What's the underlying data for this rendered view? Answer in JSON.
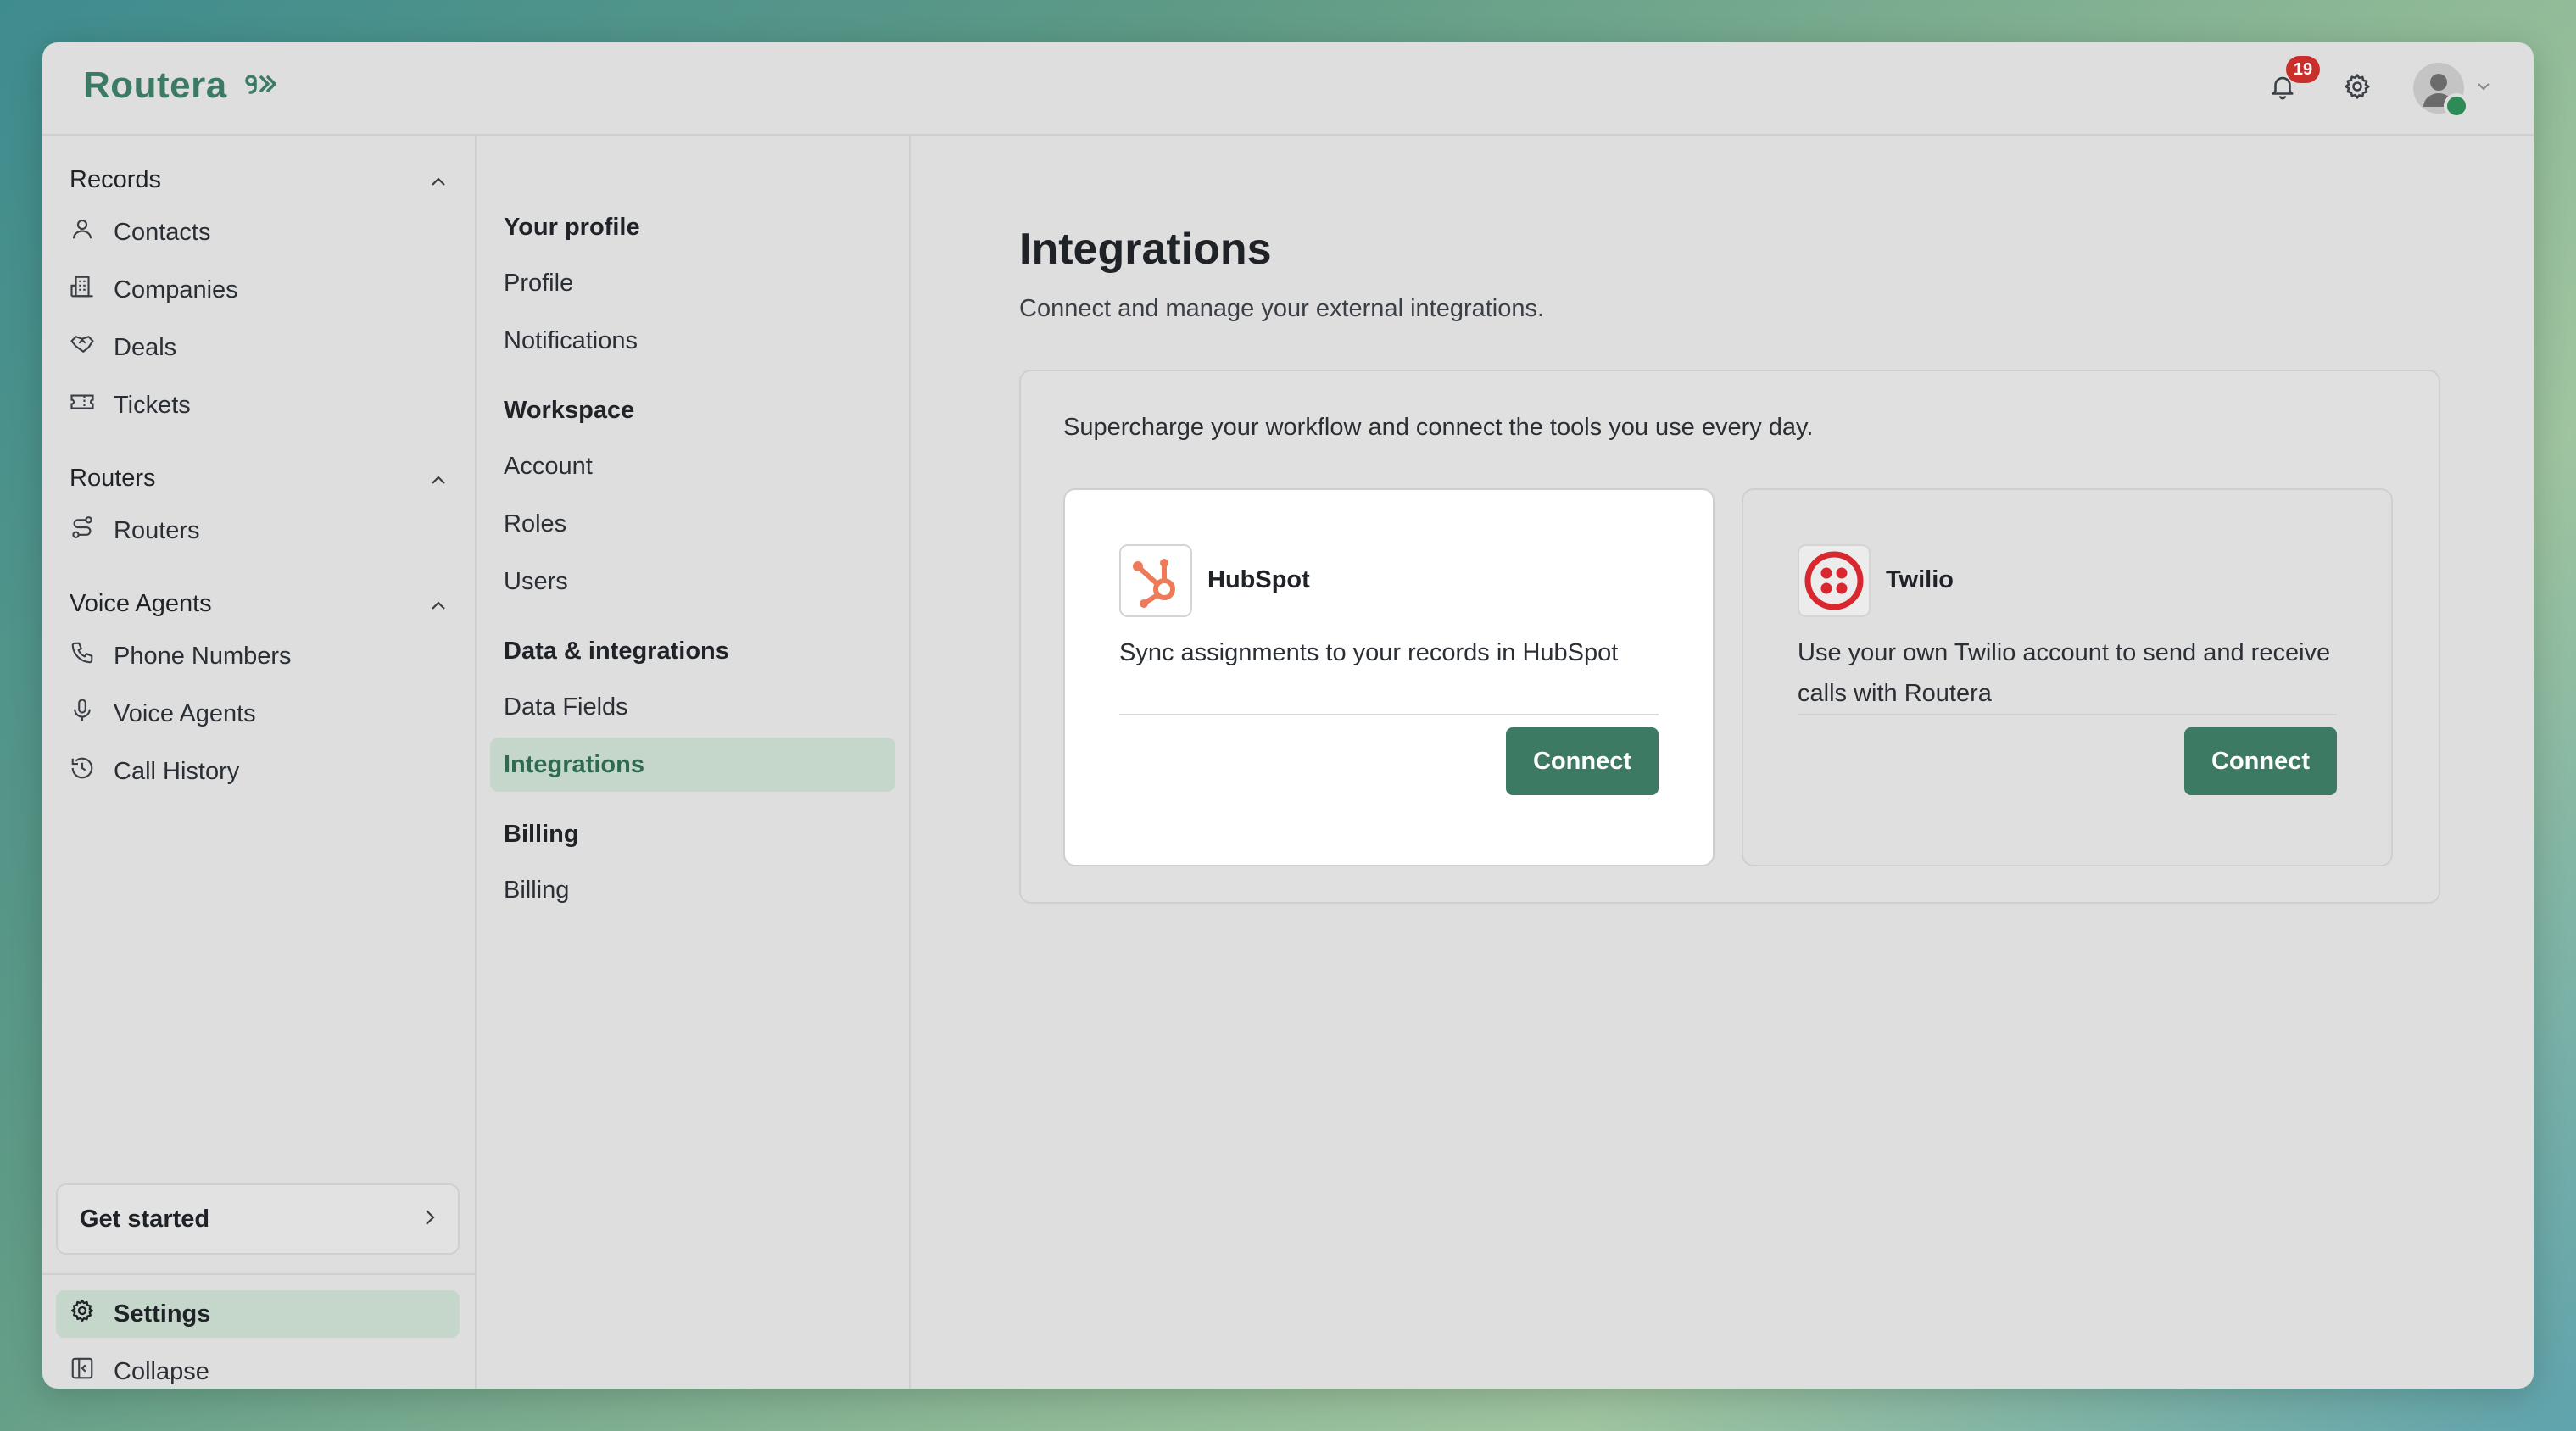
{
  "app": {
    "logo_text": "Routera",
    "brand_color": "#3d7a63"
  },
  "topbar": {
    "notification_count": "19"
  },
  "sidebar": {
    "sections": [
      {
        "title": "Records",
        "items": [
          {
            "label": "Contacts",
            "icon": "user-icon"
          },
          {
            "label": "Companies",
            "icon": "building-icon"
          },
          {
            "label": "Deals",
            "icon": "handshake-icon"
          },
          {
            "label": "Tickets",
            "icon": "ticket-icon"
          }
        ]
      },
      {
        "title": "Routers",
        "items": [
          {
            "label": "Routers",
            "icon": "route-icon"
          }
        ]
      },
      {
        "title": "Voice Agents",
        "items": [
          {
            "label": "Phone Numbers",
            "icon": "phone-icon"
          },
          {
            "label": "Voice Agents",
            "icon": "microphone-icon"
          },
          {
            "label": "Call History",
            "icon": "history-icon"
          }
        ]
      }
    ],
    "get_started": "Get started",
    "settings": "Settings",
    "collapse": "Collapse"
  },
  "subnav": {
    "groups": [
      {
        "title": "Your profile",
        "items": [
          "Profile",
          "Notifications"
        ]
      },
      {
        "title": "Workspace",
        "items": [
          "Account",
          "Roles",
          "Users"
        ]
      },
      {
        "title": "Data & integrations",
        "items": [
          "Data Fields",
          "Integrations"
        ]
      },
      {
        "title": "Billing",
        "items": [
          "Billing"
        ]
      }
    ],
    "active": "Integrations"
  },
  "main": {
    "title": "Integrations",
    "subtitle": "Connect and manage your external integrations.",
    "panel_text": "Supercharge your workflow and connect the tools you use every day.",
    "cards": [
      {
        "name": "HubSpot",
        "description": "Sync assignments to your records in HubSpot",
        "button": "Connect"
      },
      {
        "name": "Twilio",
        "description": "Use your own Twilio account to send and receive calls with Routera",
        "button": "Connect"
      }
    ]
  }
}
